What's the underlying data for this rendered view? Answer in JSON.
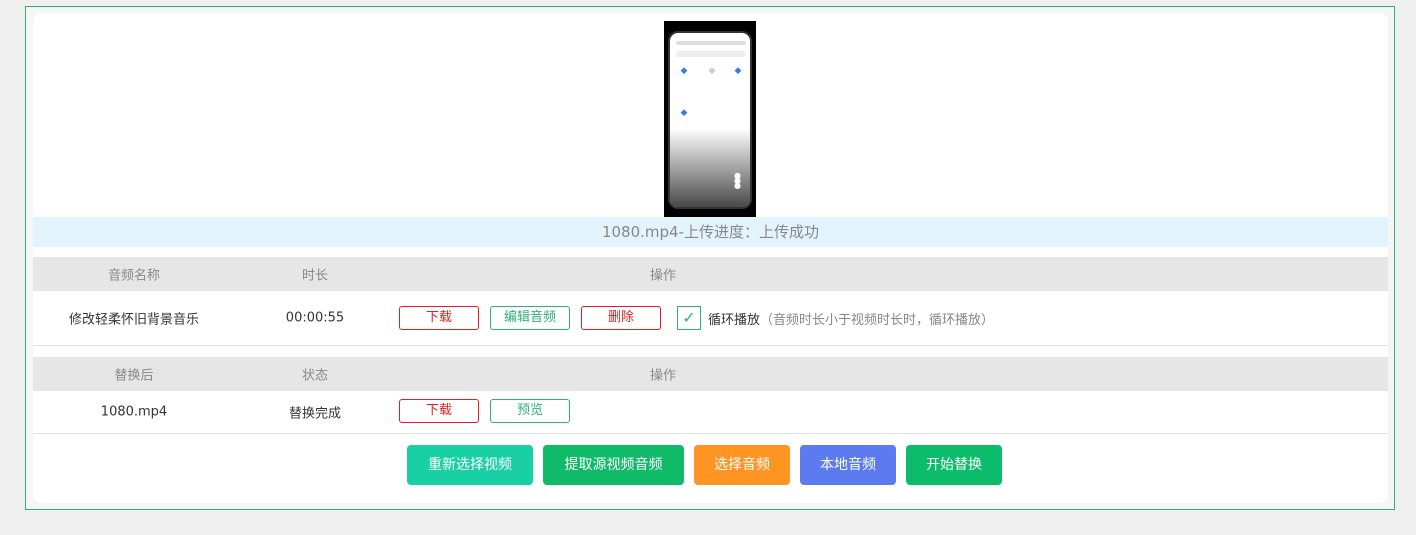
{
  "upload": {
    "status_text": "1080.mp4-上传进度：上传成功"
  },
  "audio_table": {
    "headers": {
      "name": "音频名称",
      "duration": "时长",
      "ops": "操作"
    },
    "row": {
      "name": "修改轻柔怀旧背景音乐",
      "duration": "00:00:55",
      "download_label": "下载",
      "edit_label": "编辑音频",
      "delete_label": "删除",
      "loop_checked": true,
      "loop_label": "循环播放",
      "loop_hint": "（音频时长小于视频时长时，循环播放）"
    }
  },
  "result_table": {
    "headers": {
      "name": "替换后",
      "status": "状态",
      "ops": "操作"
    },
    "row": {
      "name": "1080.mp4",
      "status": "替换完成",
      "download_label": "下载",
      "preview_label": "预览"
    }
  },
  "actions": {
    "reselect_video": "重新选择视频",
    "extract_audio": "提取源视频音频",
    "select_audio": "选择音频",
    "local_audio": "本地音频",
    "start_replace": "开始替换"
  },
  "colors": {
    "accent_green": "#2db37a",
    "danger_red": "#e02020",
    "btn_teal": "#19d0a4",
    "btn_green": "#0fba69",
    "btn_orange": "#fe9422",
    "btn_blue": "#5c7bee",
    "btn_green2": "#0bbd6a"
  }
}
